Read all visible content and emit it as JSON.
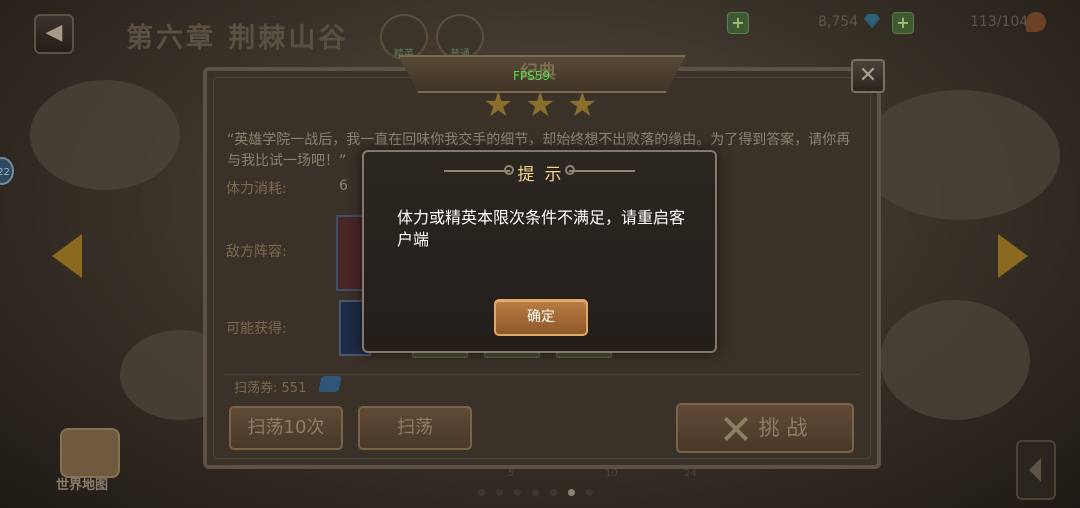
{
  "topbar": {
    "back_icon": "back-arrow-icon",
    "chapter_title": "第六章 荆棘山谷",
    "nav": [
      "精英",
      "普通"
    ],
    "diamonds": "8,754",
    "stamina": "113/104"
  },
  "side": {
    "left_badge": "22",
    "world_map_label": "世界地图",
    "node_numbers": [
      "5",
      "10",
      "24"
    ]
  },
  "stage_panel": {
    "header_title": "纪典",
    "fps": "FPS59",
    "stars": 3,
    "description": "“英雄学院一战后，我一直在回味你我交手的细节，却始终想不出败落的缘由。为了得到答案，请你再与我比试一场吧！”",
    "stamina_label": "体力消耗:",
    "stamina_value": "6",
    "enemy_label": "敌方阵容:",
    "rewards_label": "可能获得:",
    "sweep_tickets_label": "扫荡券:",
    "sweep_tickets_value": "551",
    "sweep10_label": "扫荡10次",
    "sweep_label": "扫荡",
    "challenge_label": "挑 战"
  },
  "dialog": {
    "title": "提示",
    "message": "体力或精英本限次条件不满足，请重启客户端",
    "confirm_label": "确定"
  },
  "colors": {
    "dialog_title": "#f3d488",
    "confirm_button": "#a86d39",
    "fps": "#4de04d"
  }
}
